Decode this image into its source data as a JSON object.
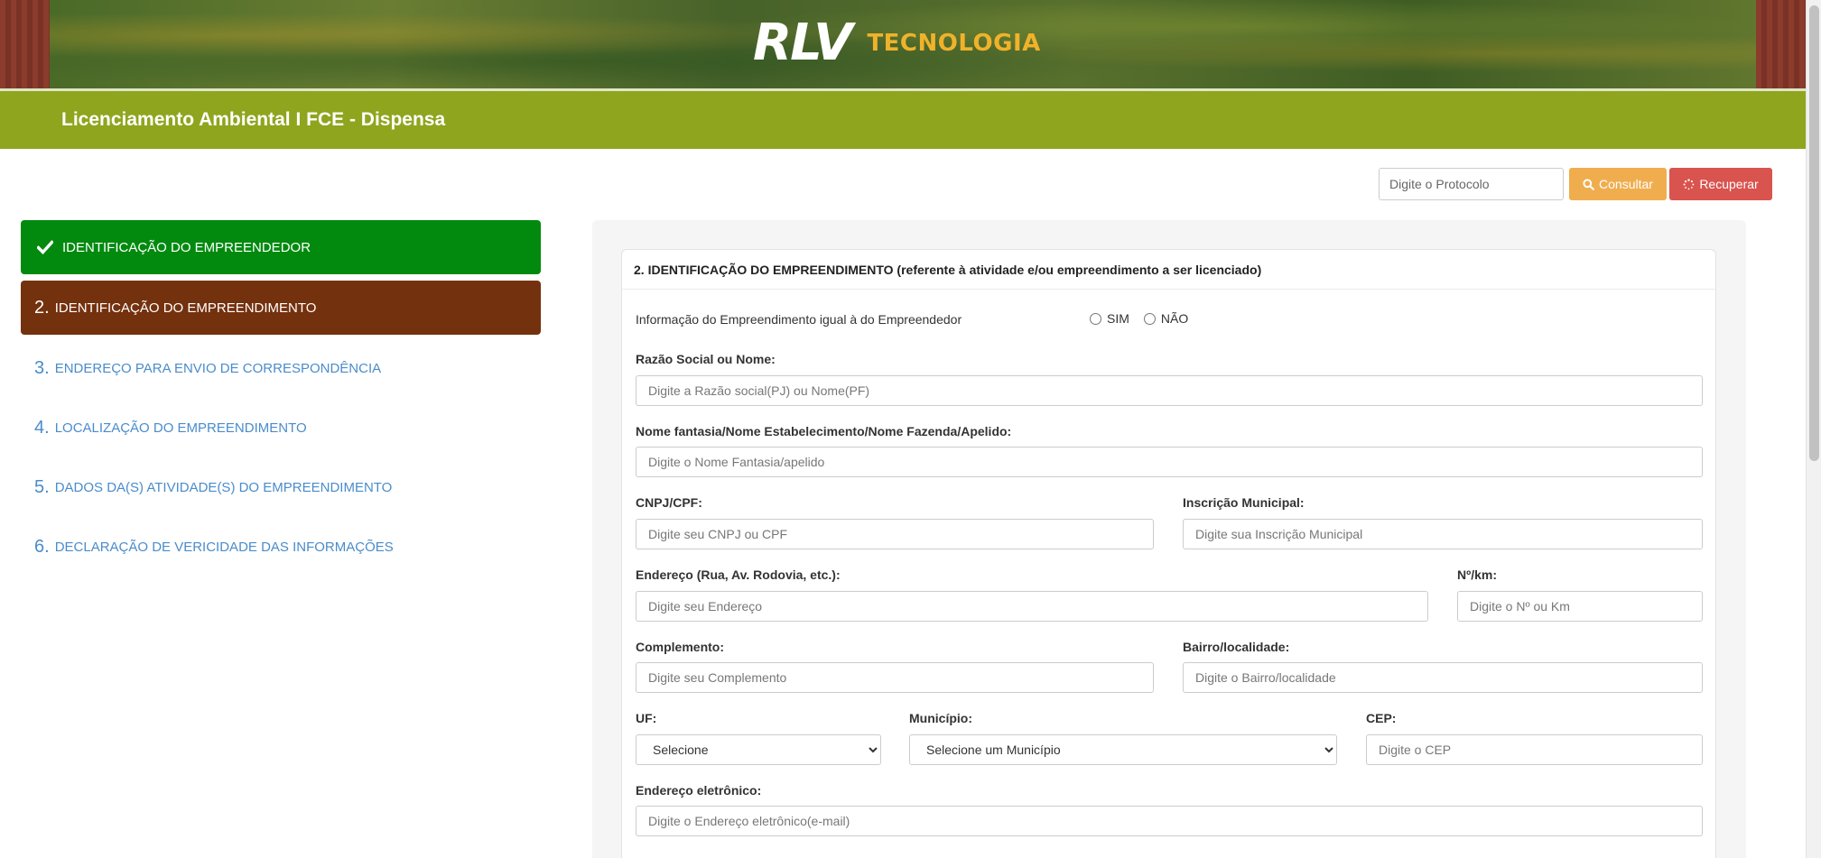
{
  "header": {
    "logo_mark": "RLV",
    "logo_text": "TECNOLOGIA",
    "title": "Licenciamento Ambiental I FCE - Dispensa"
  },
  "protocol": {
    "placeholder": "Digite o Protocolo",
    "consultar_label": "Consultar",
    "recuperar_label": "Recuperar"
  },
  "steps": [
    {
      "num": "",
      "label": "IDENTIFICAÇÃO DO EMPREENDEDOR",
      "state": "done"
    },
    {
      "num": "2.",
      "label": "IDENTIFICAÇÃO DO EMPREENDIMENTO",
      "state": "active"
    },
    {
      "num": "3.",
      "label": "ENDEREÇO PARA ENVIO DE CORRESPONDÊNCIA",
      "state": "pending"
    },
    {
      "num": "4.",
      "label": "LOCALIZAÇÃO DO EMPREENDIMENTO",
      "state": "pending"
    },
    {
      "num": "5.",
      "label": "DADOS DA(S) ATIVIDADE(S) DO EMPREENDIMENTO",
      "state": "pending"
    },
    {
      "num": "6.",
      "label": "DECLARAÇÃO DE VERICIDADE DAS INFORMAÇÕES",
      "state": "pending"
    }
  ],
  "form": {
    "title": "2. IDENTIFICAÇÃO DO EMPREENDIMENTO (referente à atividade e/ou empreendimento a ser licenciado)",
    "same_info": {
      "label": "Informação do Empreendimento igual à do Empreendedor",
      "options": [
        "SIM",
        "NÃO"
      ]
    },
    "razao_social": {
      "label": "Razão Social ou Nome:",
      "placeholder": "Digite a Razão social(PJ) ou Nome(PF)"
    },
    "nome_fantasia": {
      "label": "Nome fantasia/Nome Estabelecimento/Nome Fazenda/Apelido:",
      "placeholder": "Digite o Nome Fantasia/apelido"
    },
    "cnpj": {
      "label": "CNPJ/CPF:",
      "placeholder": "Digite seu CNPJ ou CPF"
    },
    "inscricao": {
      "label": "Inscrição Municipal:",
      "placeholder": "Digite sua Inscrição Municipal"
    },
    "endereco": {
      "label": "Endereço (Rua, Av. Rodovia, etc.):",
      "placeholder": "Digite seu Endereço"
    },
    "numero": {
      "label": "Nº/km:",
      "placeholder": "Digite o Nº ou Km"
    },
    "complemento": {
      "label": "Complemento:",
      "placeholder": "Digite seu Complemento"
    },
    "bairro": {
      "label": "Bairro/localidade:",
      "placeholder": "Digite o Bairro/localidade"
    },
    "uf": {
      "label": "UF:",
      "selected": "Selecione"
    },
    "municipio": {
      "label": "Município:",
      "selected": "Selecione um Município"
    },
    "cep": {
      "label": "CEP:",
      "placeholder": "Digite o CEP"
    },
    "email": {
      "label": "Endereço eletrônico:",
      "placeholder": "Digite o Endereço eletrônico(e-mail)"
    }
  },
  "colors": {
    "title_bar": "#8fa51e",
    "step_done": "#028a0f",
    "step_active": "#74310e",
    "step_link": "#4a8ccb",
    "consultar": "#f0ad4e",
    "recuperar": "#d9534f",
    "logo_accent": "#f0b22a"
  }
}
